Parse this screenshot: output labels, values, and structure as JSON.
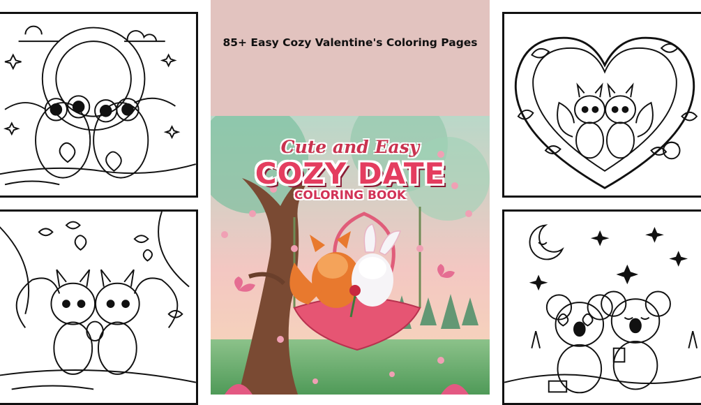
{
  "header": {
    "title": "85+ Easy Cozy Valentine's Coloring Pages"
  },
  "cover": {
    "line1": "Cute and Easy",
    "line2": "COZY DATE",
    "line3": "COLORING BOOK"
  },
  "pages": [
    {
      "subject": "owls-on-branch"
    },
    {
      "subject": "squirrels-in-tree"
    },
    {
      "subject": "squirrels-in-heart-wreath"
    },
    {
      "subject": "koalas-picnic"
    }
  ],
  "colors": {
    "center_background": "#e2c3bf",
    "title_accent": "#e43d5f",
    "outline": "#111111"
  }
}
